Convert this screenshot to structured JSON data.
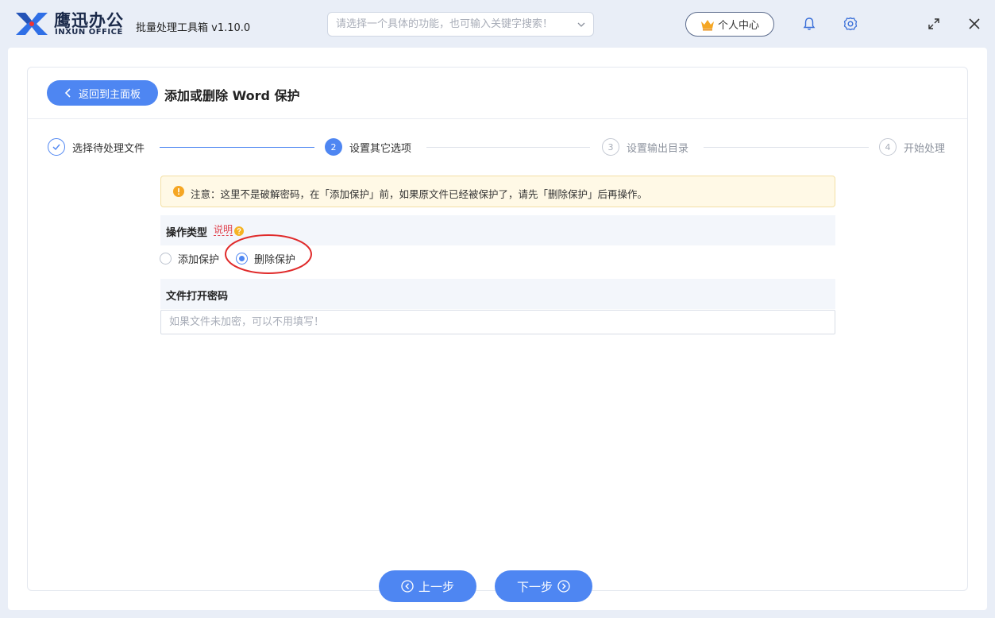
{
  "app": {
    "brand_cn": "鹰迅办公",
    "brand_en": "INXUN OFFICE",
    "title": "批量处理工具箱 v1.10.0"
  },
  "search": {
    "placeholder": "请选择一个具体的功能，也可输入关键字搜索！",
    "value": ""
  },
  "header": {
    "user_center_label": "个人中心"
  },
  "page": {
    "back_label": "返回到主面板",
    "title": "添加或删除 Word 保护"
  },
  "steps": [
    {
      "number": "1",
      "label": "选择待处理文件",
      "status": "done"
    },
    {
      "number": "2",
      "label": "设置其它选项",
      "status": "active"
    },
    {
      "number": "3",
      "label": "设置输出目录",
      "status": "pending"
    },
    {
      "number": "4",
      "label": "开始处理",
      "status": "pending"
    }
  ],
  "notice": {
    "text": "注意：这里不是破解密码，在「添加保护」前，如果原文件已经被保护了，请先「删除保护」后再操作。"
  },
  "operation": {
    "label": "操作类型",
    "help_label": "说明",
    "options": [
      {
        "label": "添加保护",
        "selected": false
      },
      {
        "label": "删除保护",
        "selected": true
      }
    ]
  },
  "password": {
    "label": "文件打开密码",
    "placeholder": "如果文件未加密，可以不用填写！",
    "value": ""
  },
  "nav": {
    "prev_label": "上一步",
    "next_label": "下一步"
  },
  "colors": {
    "accent": "#4e86f2",
    "highlight_ellipse": "#e02b2b",
    "warning": "#f5a623"
  }
}
